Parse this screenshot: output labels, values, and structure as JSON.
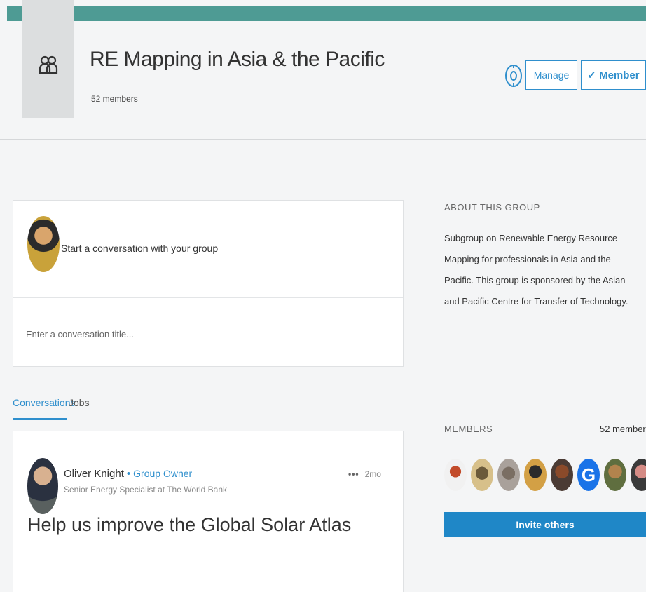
{
  "header": {
    "group_name": "RE Mapping in Asia & the Pacific",
    "member_count": "52 members",
    "manage_label": "Manage",
    "member_label": "✓ Member",
    "accent_color": "#4e9b94"
  },
  "composer": {
    "prompt": "Start a conversation with your group",
    "title_placeholder": "Enter a conversation title..."
  },
  "tabs": [
    {
      "label": "Conversations",
      "active": true
    },
    {
      "label": "Jobs",
      "active": false
    }
  ],
  "post": {
    "author": "Oliver Knight",
    "role_badge": "Group Owner",
    "headline": "Senior Energy Specialist at The World Bank",
    "time": "2mo",
    "title": "Help us improve the Global Solar Atlas"
  },
  "about": {
    "heading": "ABOUT THIS GROUP",
    "text": "Subgroup on Renewable Energy Resource Mapping for professionals in Asia and the Pacific. This group is sponsored by the Asian and Pacific Centre for Transfer of Technology."
  },
  "members_panel": {
    "heading": "MEMBERS",
    "count": "52 members",
    "invite_label": "Invite others",
    "avatar_letter": "G"
  },
  "colors": {
    "link": "#2f8fcd",
    "invite_button": "#1f87c7"
  },
  "icons": [
    "group-icon",
    "gear-icon",
    "more-options-icon"
  ]
}
